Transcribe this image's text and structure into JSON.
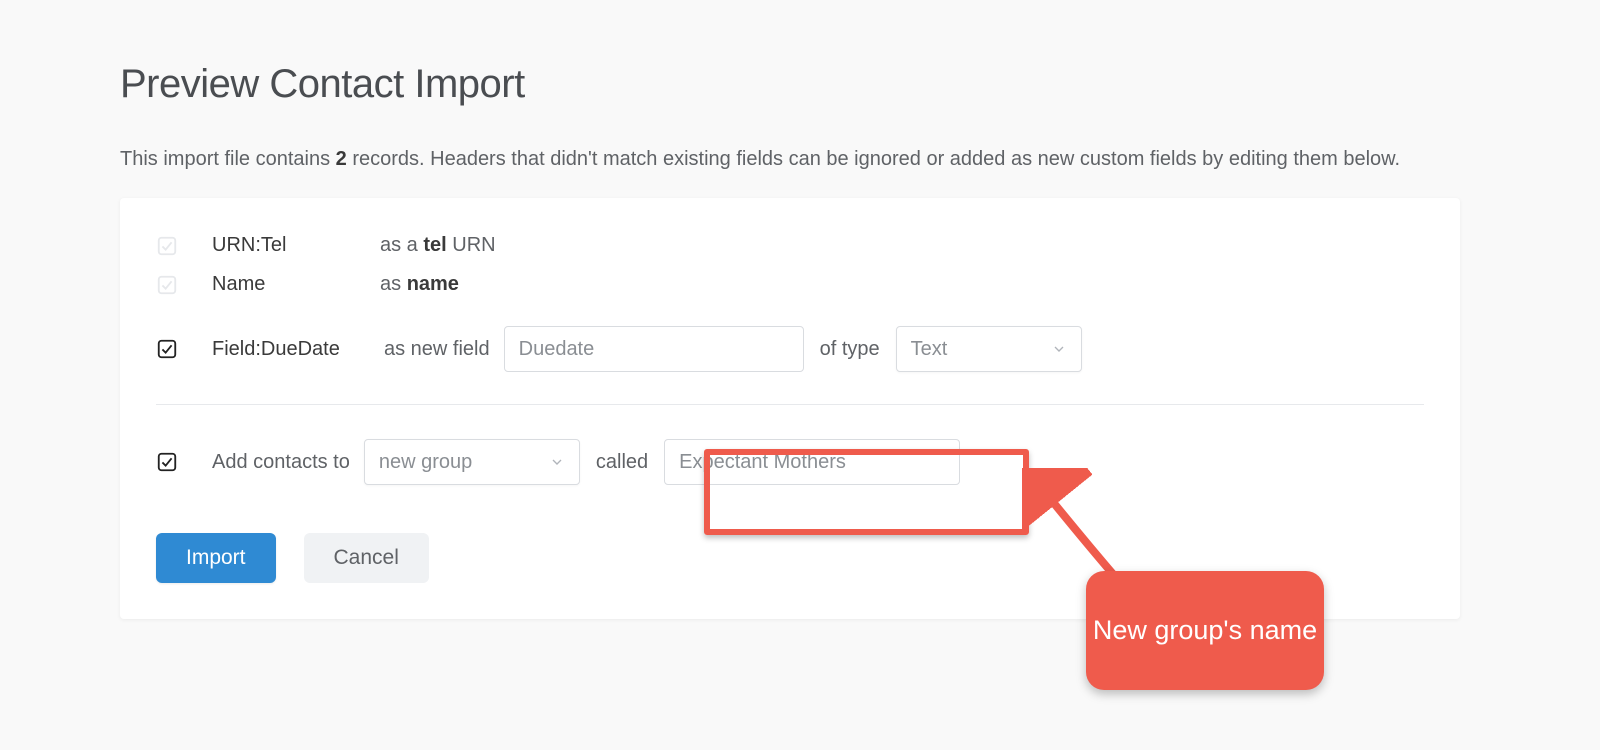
{
  "title": "Preview Contact Import",
  "intro_prefix": "This import file contains ",
  "record_count": "2",
  "intro_suffix": " records. Headers that didn't match existing fields can be ignored or added as new custom fields by editing them below.",
  "rows": [
    {
      "header": "URN:Tel",
      "desc_pre": "as a ",
      "desc_b": "tel",
      "desc_post": " URN",
      "checked": true,
      "disabled": true
    },
    {
      "header": "Name",
      "desc_pre": "as ",
      "desc_b": "name",
      "desc_post": "",
      "checked": true,
      "disabled": true
    }
  ],
  "newfield": {
    "header": "Field:DueDate",
    "label_pre": "as new field",
    "name_value": "Duedate",
    "of_type_label": "of type",
    "type_value": "Text"
  },
  "group": {
    "add_label": "Add contacts to",
    "mode_value": "new group",
    "called_label": "called",
    "name_value": "Expectant Mothers"
  },
  "buttons": {
    "import": "Import",
    "cancel": "Cancel"
  },
  "callout_text": "New group's name"
}
